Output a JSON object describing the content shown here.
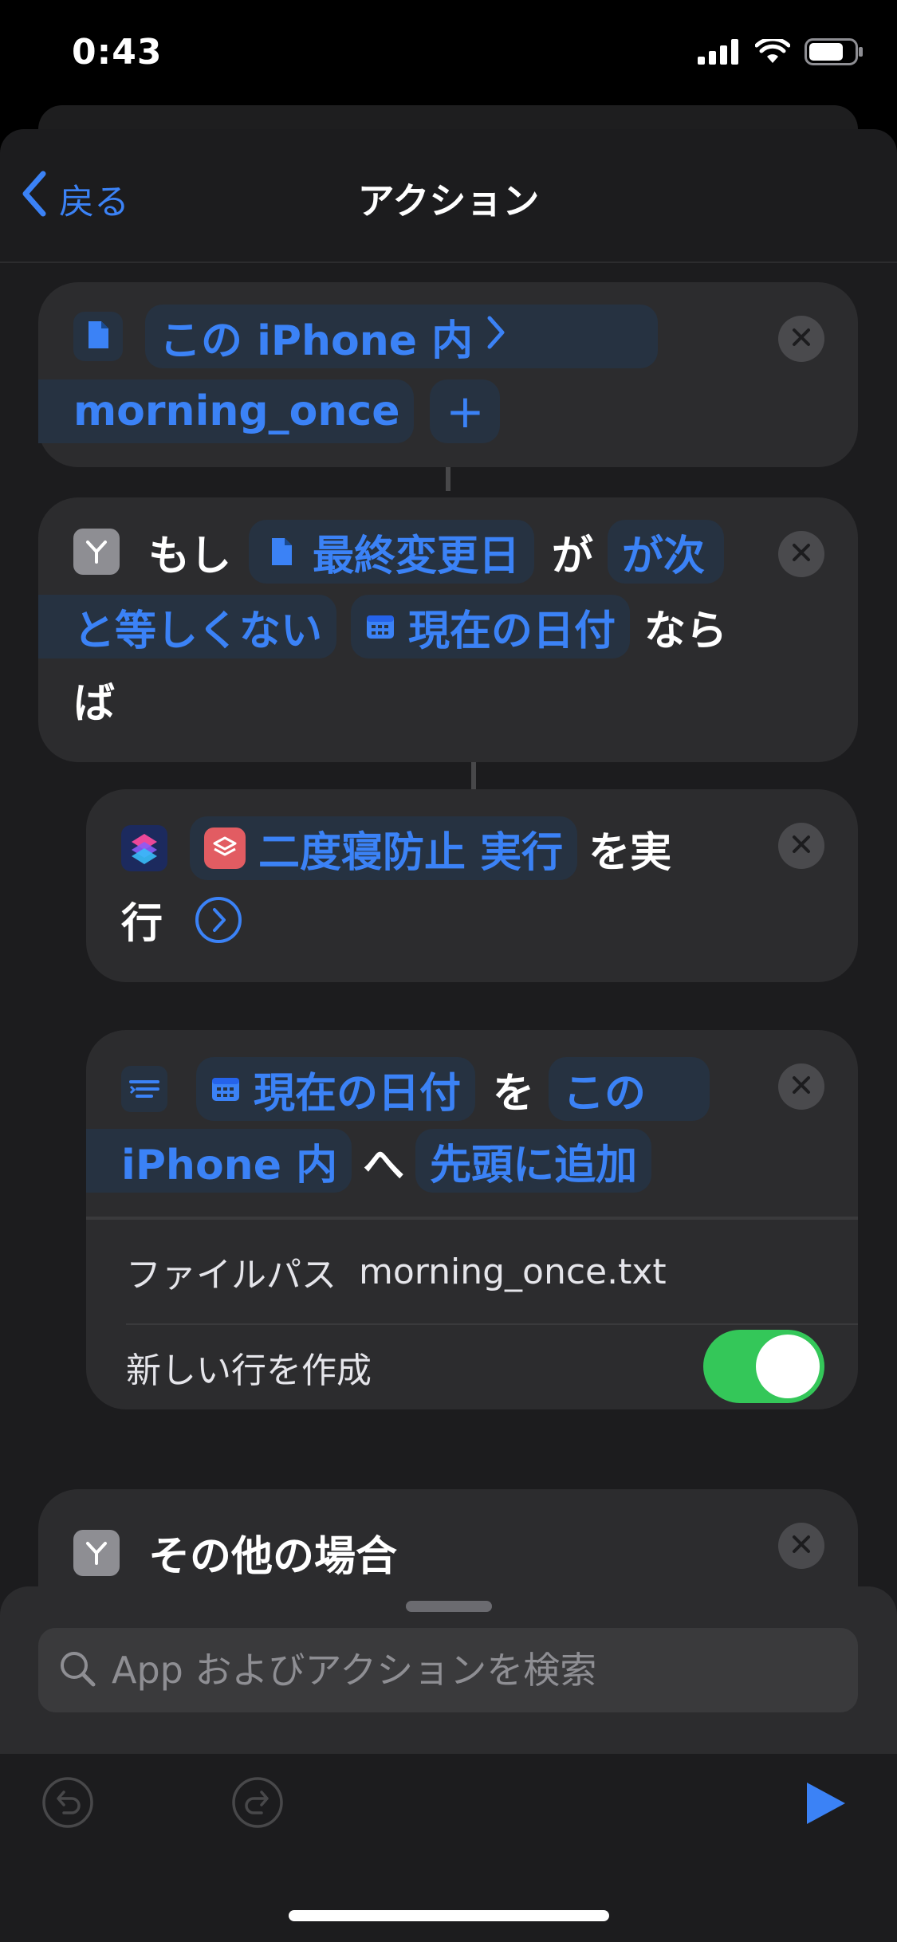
{
  "status": {
    "time": "0:43"
  },
  "nav": {
    "back_label": "戻る",
    "title": "アクション"
  },
  "card1": {
    "location": "この iPhone 内",
    "filename": "morning_once",
    "add_symbol": "+"
  },
  "card2": {
    "if_word": "もし",
    "field": "最終変更日",
    "particle_ga": "が",
    "cond_1": "が次",
    "cond_2": "と等しくない",
    "value": "現在の日付",
    "suffix_1": "なら",
    "suffix_2": "ば"
  },
  "card3": {
    "shortcut_name": "二度寝防止 実行",
    "suffix_1": "を実",
    "suffix_2": "行"
  },
  "card4": {
    "date": "現在の日付",
    "particle_wo": "を",
    "location_1": "この",
    "location_2": "iPhone 内",
    "particle_he": "へ",
    "mode": "先頭に追加",
    "filepath_label": "ファイルパス",
    "filepath_value": "morning_once.txt",
    "newline_label": "新しい行を作成",
    "newline_on": true
  },
  "card5": {
    "otherwise_label": "その他の場合"
  },
  "search": {
    "placeholder": "App およびアクションを検索"
  },
  "colors": {
    "accent": "#3b82f6",
    "toggle_on": "#34c759",
    "card_bg": "#2c2c2e",
    "sheet_bg": "#1c1c1e"
  }
}
